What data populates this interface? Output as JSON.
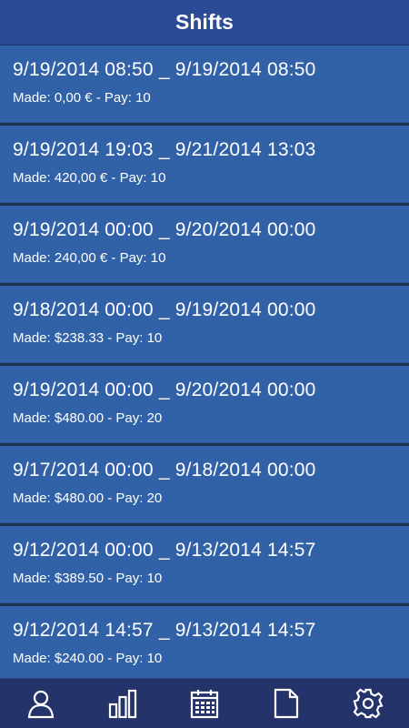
{
  "header": {
    "title": "Shifts"
  },
  "shifts": [
    {
      "range": "9/19/2014 08:50 _ 9/19/2014 08:50",
      "made": "Made: 0,00 € - Pay: 10"
    },
    {
      "range": "9/19/2014 19:03 _ 9/21/2014 13:03",
      "made": "Made: 420,00 € - Pay: 10"
    },
    {
      "range": "9/19/2014 00:00 _ 9/20/2014 00:00",
      "made": "Made: 240,00 € - Pay: 10"
    },
    {
      "range": "9/18/2014 00:00 _ 9/19/2014 00:00",
      "made": "Made: $238.33 - Pay: 10"
    },
    {
      "range": "9/19/2014 00:00 _ 9/20/2014 00:00",
      "made": "Made: $480.00 - Pay: 20"
    },
    {
      "range": "9/17/2014 00:00 _ 9/18/2014 00:00",
      "made": "Made: $480.00 - Pay: 20"
    },
    {
      "range": "9/12/2014 00:00 _ 9/13/2014 14:57",
      "made": "Made: $389.50 - Pay: 10"
    },
    {
      "range": "9/12/2014 14:57 _ 9/13/2014 14:57",
      "made": "Made: $240.00 - Pay: 10"
    }
  ],
  "tabs": [
    {
      "icon": "user-icon"
    },
    {
      "icon": "bar-chart-icon"
    },
    {
      "icon": "calendar-icon"
    },
    {
      "icon": "document-icon"
    },
    {
      "icon": "gear-icon"
    }
  ],
  "colors": {
    "header": "#2b4b97",
    "item": "#3161a7",
    "tabbar": "#24336a",
    "text": "#ffffff"
  }
}
